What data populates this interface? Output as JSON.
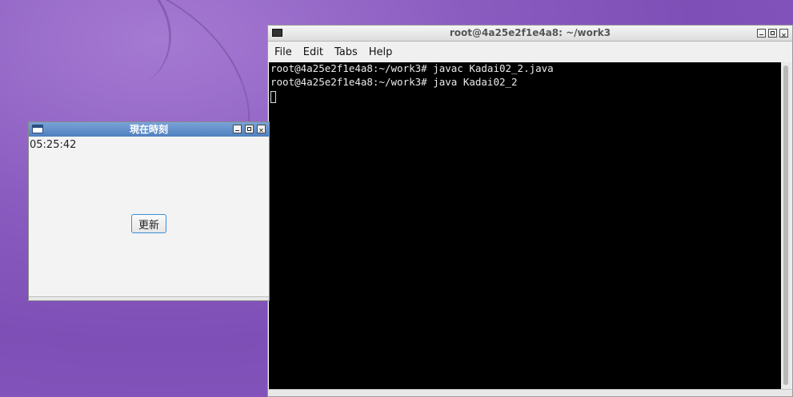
{
  "desktop": {
    "wallpaper": "purple-swoosh"
  },
  "clock_window": {
    "title": "現在時刻",
    "time": "05:25:42",
    "update_button_label": "更新"
  },
  "terminal_window": {
    "title": "root@4a25e2f1e4a8: ~/work3",
    "menu": [
      "File",
      "Edit",
      "Tabs",
      "Help"
    ],
    "lines": [
      "root@4a25e2f1e4a8:~/work3# javac Kadai02_2.java",
      "root@4a25e2f1e4a8:~/work3# java Kadai02_2"
    ]
  },
  "colors": {
    "clock_titlebar": "#5a88c6",
    "button_border": "#3c8fd6",
    "terminal_bg": "#000000",
    "desktop": "#8a5cc0"
  }
}
